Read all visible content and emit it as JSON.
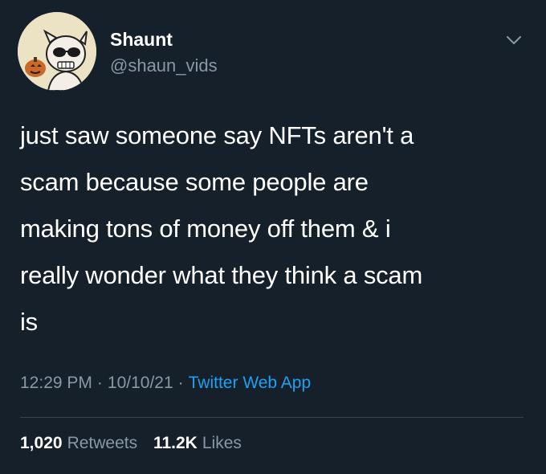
{
  "author": {
    "display_name": "Shaunt",
    "handle": "@shaun_vids",
    "avatar_icon": "cartoon-avatar-icon"
  },
  "menu_icon": "chevron-down-icon",
  "tweet": {
    "text": "just saw someone say NFTs aren't a\nscam because some people are\nmaking tons of money off them & i\nreally wonder what they think a scam\nis"
  },
  "meta": {
    "time": "12:29 PM",
    "separator_1": "·",
    "date": "10/10/21",
    "separator_2": "·",
    "source": "Twitter Web App"
  },
  "stats": {
    "retweets_count": "1,020",
    "retweets_label": "Retweets",
    "likes_count": "11.2K",
    "likes_label": "Likes"
  },
  "colors": {
    "background": "#15202b",
    "text_primary": "#ffffff",
    "text_secondary": "#8899a6",
    "link": "#1da1f2",
    "divider": "#38444d"
  }
}
